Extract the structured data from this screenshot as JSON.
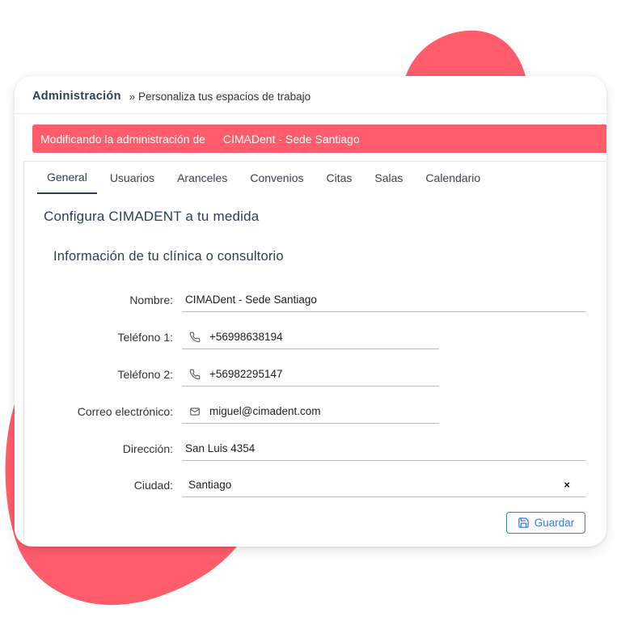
{
  "breadcrumb": {
    "root": "Administración",
    "separator": "»",
    "page": "Personaliza tus espacios de trabajo"
  },
  "banner": {
    "prefix": "Modificando la administración de",
    "clinic": "CIMADent - Sede Santiago"
  },
  "tabs": [
    {
      "label": "General",
      "active": true
    },
    {
      "label": "Usuarios",
      "active": false
    },
    {
      "label": "Aranceles",
      "active": false
    },
    {
      "label": "Convenios",
      "active": false
    },
    {
      "label": "Citas",
      "active": false
    },
    {
      "label": "Salas",
      "active": false
    },
    {
      "label": "Calendario",
      "active": false
    }
  ],
  "section_title": "Configura CIMADENT a tu medida",
  "subsection_title": "Información de tu clínica o consultorio",
  "form": {
    "nombre": {
      "label": "Nombre:",
      "value": "CIMADent - Sede Santiago"
    },
    "telefono1": {
      "label": "Teléfono 1:",
      "value": "+56998638194",
      "icon": "phone-icon"
    },
    "telefono2": {
      "label": "Teléfono 2:",
      "value": "+56982295147",
      "icon": "phone-icon"
    },
    "correo": {
      "label": "Correo electrónico:",
      "value": "miguel@cimadent.com",
      "icon": "mail-icon"
    },
    "direccion": {
      "label": "Dirección:",
      "value": "San Luis 4354"
    },
    "ciudad": {
      "label": "Ciudad:",
      "value": "Santiago",
      "clear": "×"
    }
  },
  "save_button": {
    "label": "Guardar",
    "icon": "save-icon"
  },
  "colors": {
    "accent": "#ff5d6c",
    "heading": "#2f3e57",
    "button": "#3d78d8"
  }
}
